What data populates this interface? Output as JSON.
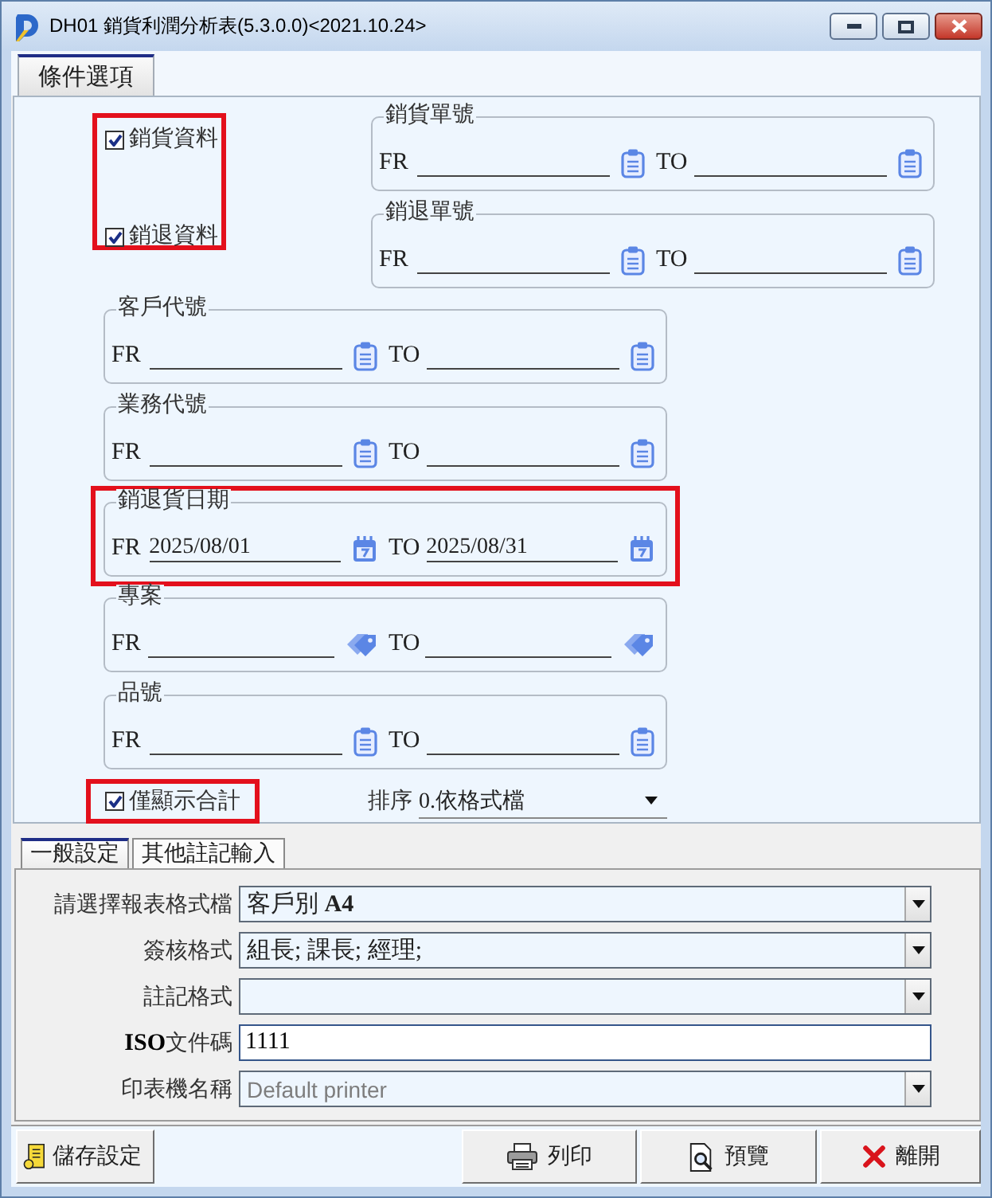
{
  "window": {
    "title": "DH01 銷貨利潤分析表(5.3.0.0)<2021.10.24>"
  },
  "top_tabs": [
    {
      "label": "條件選項",
      "selected": true
    }
  ],
  "data_options": {
    "highlighted": true,
    "items": [
      {
        "label": "銷貨資料",
        "checked": true
      },
      {
        "label": "銷退資料",
        "checked": true
      }
    ]
  },
  "document_ranges": [
    {
      "title": "銷貨單號",
      "kind": "lookup",
      "from": {
        "label": "FR"
      },
      "to": {
        "label": "TO"
      }
    },
    {
      "title": "銷退單號",
      "kind": "lookup",
      "from": {
        "label": "FR"
      },
      "to": {
        "label": "TO"
      }
    }
  ],
  "ranges": [
    {
      "title": "客戶代號",
      "kind": "lookup",
      "highlighted": false,
      "from": {
        "label": "FR"
      },
      "to": {
        "label": "TO"
      }
    },
    {
      "title": "業務代號",
      "kind": "lookup",
      "highlighted": false,
      "from": {
        "label": "FR"
      },
      "to": {
        "label": "TO"
      }
    },
    {
      "title": "銷退貨日期",
      "kind": "date",
      "highlighted": true,
      "from": {
        "label": "FR",
        "value": "2025/08/01"
      },
      "to": {
        "label": "TO",
        "value": "2025/08/31"
      }
    },
    {
      "title": "專案",
      "kind": "tag",
      "highlighted": false,
      "from": {
        "label": "FR"
      },
      "to": {
        "label": "TO"
      }
    },
    {
      "title": "品號",
      "kind": "lookup",
      "highlighted": false,
      "from": {
        "label": "FR"
      },
      "to": {
        "label": "TO"
      }
    }
  ],
  "summary_only": {
    "label": "僅顯示合計",
    "checked": true,
    "highlighted": true
  },
  "sort": {
    "label": "排序",
    "value": "0.依格式檔"
  },
  "bottom_tabs": [
    {
      "label": "一般設定",
      "selected": true
    },
    {
      "label": "其他註記輸入",
      "selected": false
    }
  ],
  "settings": [
    {
      "label": "請選擇報表格式檔",
      "kind": "dropdown",
      "value": "客戶別 **A4**"
    },
    {
      "label": "簽核格式",
      "kind": "dropdown",
      "value": "組長; 課長; 經理;"
    },
    {
      "label": "註記格式",
      "kind": "dropdown"
    },
    {
      "label": "**ISO**文件碼",
      "kind": "text",
      "value": "1111"
    },
    {
      "label": "印表機名稱",
      "kind": "dropdown",
      "placeholder": "Default printer"
    }
  ],
  "buttons": [
    {
      "kind": "save",
      "label": "儲存設定"
    },
    {
      "kind": "print",
      "label": "列印"
    },
    {
      "kind": "preview",
      "label": "預覽"
    },
    {
      "kind": "exit",
      "label": "離開"
    }
  ]
}
